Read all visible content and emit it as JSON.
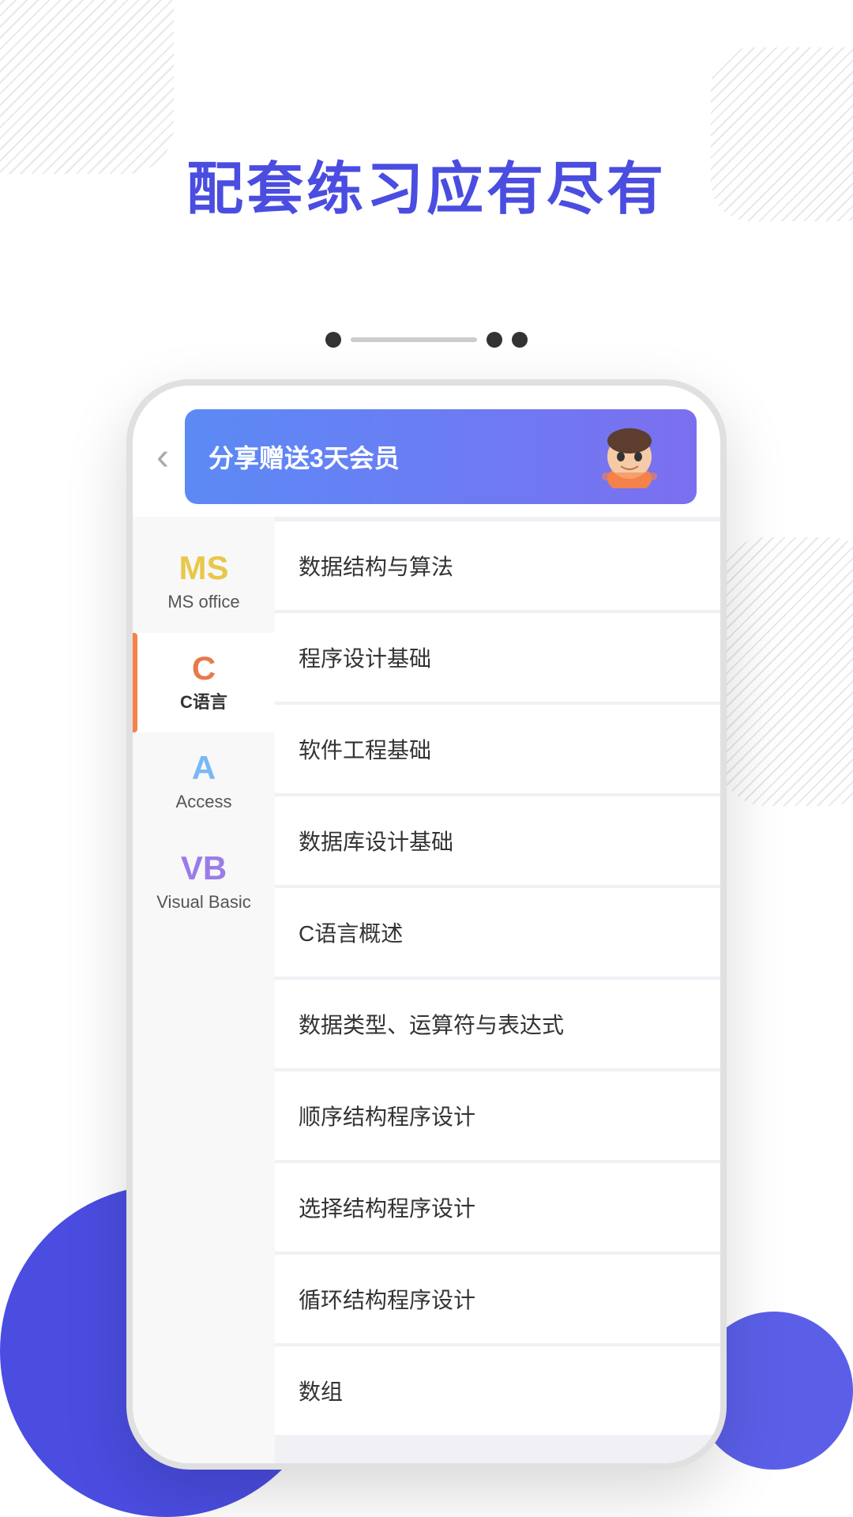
{
  "background": {
    "accent_color": "#4a4de0",
    "secondary_color": "#5b5fe8"
  },
  "header": {
    "title": "配套练习应有尽有"
  },
  "dots": [
    "filled",
    "line",
    "filled",
    "filled"
  ],
  "banner": {
    "text": "分享赠送3天会员",
    "mascot_alt": "mascot character"
  },
  "back_button": "‹",
  "sidebar": {
    "items": [
      {
        "icon": "MS",
        "icon_color": "#e8c84a",
        "label": "MS office",
        "active": false
      },
      {
        "icon": "C",
        "icon_color": "#e87a4a",
        "label": "C语言",
        "active": true
      },
      {
        "icon": "A",
        "icon_color": "#7ab8f5",
        "label": "Access",
        "active": false
      },
      {
        "icon": "VB",
        "icon_color": "#9b7be8",
        "label": "Visual Basic",
        "active": false
      }
    ]
  },
  "list": {
    "items": [
      "数据结构与算法",
      "程序设计基础",
      "软件工程基础",
      "数据库设计基础",
      "C语言概述",
      "数据类型、运算符与表达式",
      "顺序结构程序设计",
      "选择结构程序设计",
      "循环结构程序设计",
      "数组"
    ]
  }
}
